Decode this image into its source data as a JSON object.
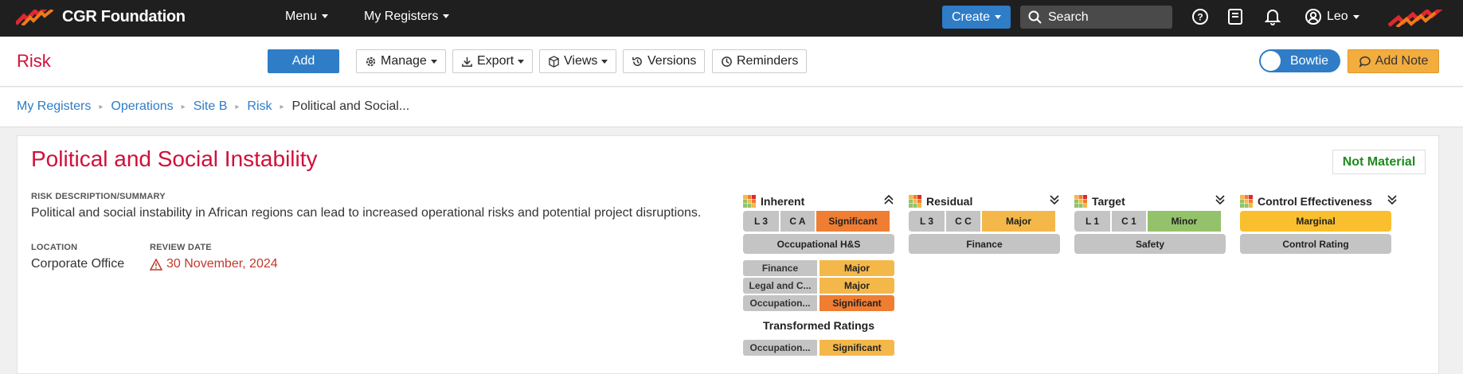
{
  "topbar": {
    "brand": "CGR Foundation",
    "menu_label": "Menu",
    "registers_label": "My Registers",
    "create_label": "Create",
    "search_placeholder": "Search",
    "user_name": "Leo",
    "icons": [
      "help-icon",
      "book-icon",
      "bell-icon",
      "user-icon"
    ]
  },
  "header": {
    "title": "Risk",
    "add_label": "Add",
    "manage_label": "Manage",
    "export_label": "Export",
    "views_label": "Views",
    "versions_label": "Versions",
    "reminders_label": "Reminders",
    "bowtie_label": "Bowtie",
    "addnote_label": "Add Note"
  },
  "breadcrumb": [
    "My Registers",
    "Operations",
    "Site B",
    "Risk",
    "Political and Social..."
  ],
  "risk": {
    "title": "Political and Social Instability",
    "materiality": "Not Material",
    "desc_label": "RISK DESCRIPTION/SUMMARY",
    "description": "Political and social instability in African regions can lead to increased operational risks and potential project disruptions.",
    "location_label": "LOCATION",
    "location": "Corporate Office",
    "review_label": "REVIEW DATE",
    "review_date": "30 November, 2024"
  },
  "ratings": {
    "inherent": {
      "title": "Inherent",
      "likelihood": "L 3",
      "consequence": "C A",
      "level": "Significant",
      "category": "Occupational H&S",
      "details": [
        {
          "name": "Finance",
          "level": "Major"
        },
        {
          "name": "Legal and C...",
          "level": "Major"
        },
        {
          "name": "Occupation...",
          "level": "Significant"
        }
      ],
      "transformed_label": "Transformed Ratings",
      "transformed": [
        {
          "name": "Occupation...",
          "level": "Significant"
        }
      ]
    },
    "residual": {
      "title": "Residual",
      "likelihood": "L 3",
      "consequence": "C C",
      "level": "Major",
      "category": "Finance"
    },
    "target": {
      "title": "Target",
      "likelihood": "L 1",
      "consequence": "C 1",
      "level": "Minor",
      "category": "Safety"
    },
    "control": {
      "title": "Control Effectiveness",
      "level": "Marginal",
      "category": "Control Rating"
    }
  },
  "colors": {
    "significant": "#ef7d32",
    "major": "#f4b84a",
    "minor": "#94c26a",
    "marginal": "#f9bf2e",
    "accent": "#2f7cc7",
    "title_red": "#d0103a"
  }
}
